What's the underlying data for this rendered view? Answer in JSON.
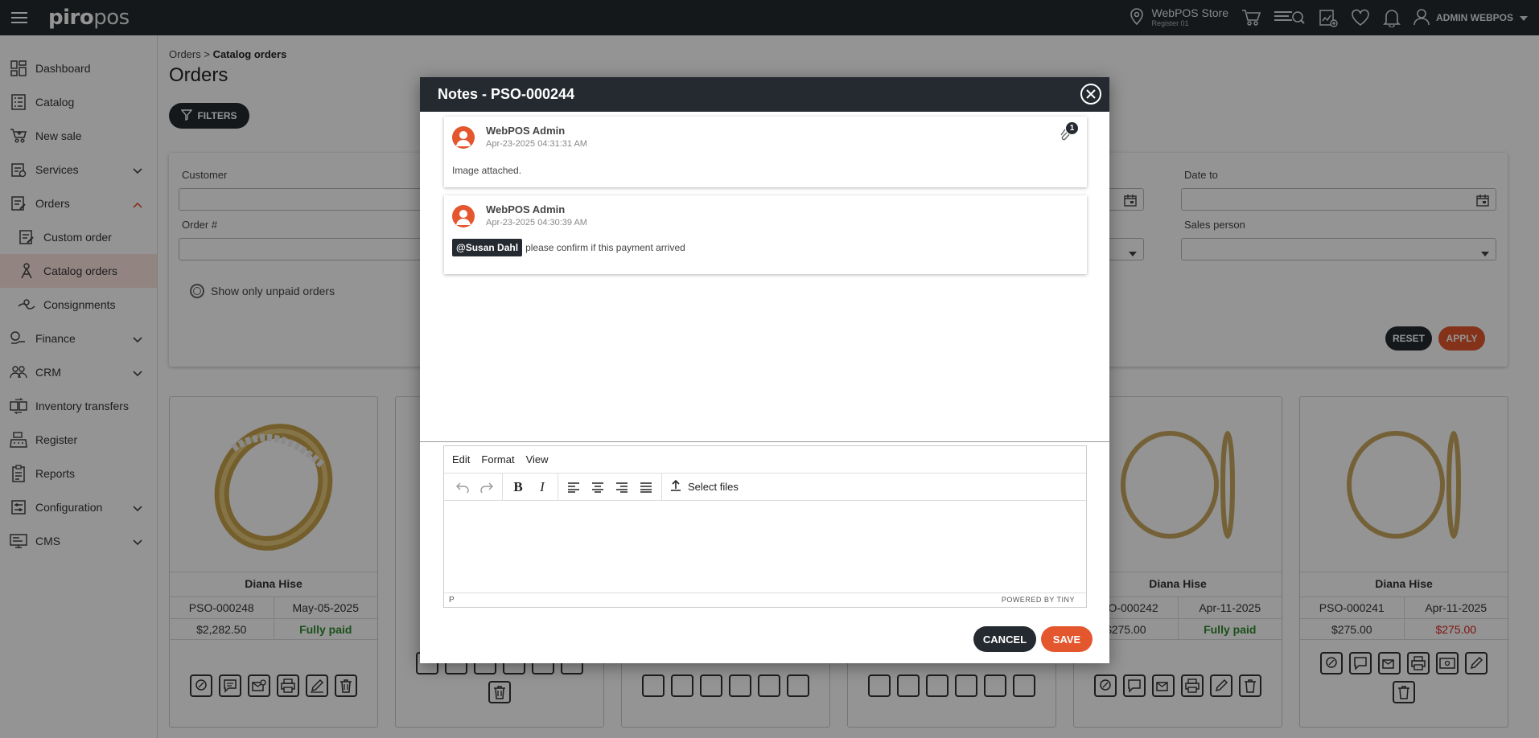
{
  "topbar": {
    "logo_text": "piropos",
    "store_name": "WebPOS Store",
    "register": "Register 01",
    "user_name": "ADMIN WEBPOS"
  },
  "sidebar": {
    "items": [
      {
        "label": "Dashboard"
      },
      {
        "label": "Catalog"
      },
      {
        "label": "New sale"
      },
      {
        "label": "Services"
      },
      {
        "label": "Orders"
      },
      {
        "label": "Custom order"
      },
      {
        "label": "Catalog orders"
      },
      {
        "label": "Consignments"
      },
      {
        "label": "Finance"
      },
      {
        "label": "CRM"
      },
      {
        "label": "Inventory transfers"
      },
      {
        "label": "Register"
      },
      {
        "label": "Reports"
      },
      {
        "label": "Configuration"
      },
      {
        "label": "CMS"
      }
    ]
  },
  "main": {
    "breadcrumb_parent": "Orders",
    "breadcrumb_sep": " > ",
    "breadcrumb_current": "Catalog orders",
    "title": "Orders",
    "filters_label": "FILTERS",
    "filter_customer": "Customer",
    "filter_order": "Order #",
    "filter_date_to": "Date to",
    "filter_sales_person": "Sales person",
    "unpaid_label": "Show only unpaid orders",
    "reset_label": "RESET",
    "apply_label": "APPLY"
  },
  "cards": [
    {
      "name": "Diana Hise",
      "order": "PSO-000248",
      "date": "May-05-2025",
      "total": "$2,282.50",
      "status": "Fully paid"
    },
    {
      "name": "Diana Hise",
      "order": "PSO-000242",
      "date": "Apr-11-2025",
      "total": "$275.00",
      "status": "Fully paid"
    },
    {
      "name": "Diana Hise",
      "order": "PSO-000241",
      "date": "Apr-11-2025",
      "total": "$275.00",
      "status": "$275.00"
    }
  ],
  "modal": {
    "title": "Notes - PSO-000244",
    "notes": [
      {
        "author": "WebPOS Admin",
        "date": "Apr-23-2025 04:31:31 AM",
        "text": "Image attached.",
        "attachments": "1"
      },
      {
        "author": "WebPOS Admin",
        "date": "Apr-23-2025 04:30:39 AM",
        "mention": "@Susan Dahl",
        "text": "please confirm if this payment arrived"
      }
    ],
    "editor": {
      "menu_edit": "Edit",
      "menu_format": "Format",
      "menu_view": "View",
      "bold": "B",
      "italic": "I",
      "select_files": "Select files",
      "status_element": "P",
      "powered_by": "POWERED BY TINY"
    },
    "cancel_label": "CANCEL",
    "save_label": "SAVE"
  },
  "colors": {
    "dark": "#242a30",
    "accent": "#e4572e",
    "paid": "#2e8b2e",
    "due": "#d22222"
  }
}
